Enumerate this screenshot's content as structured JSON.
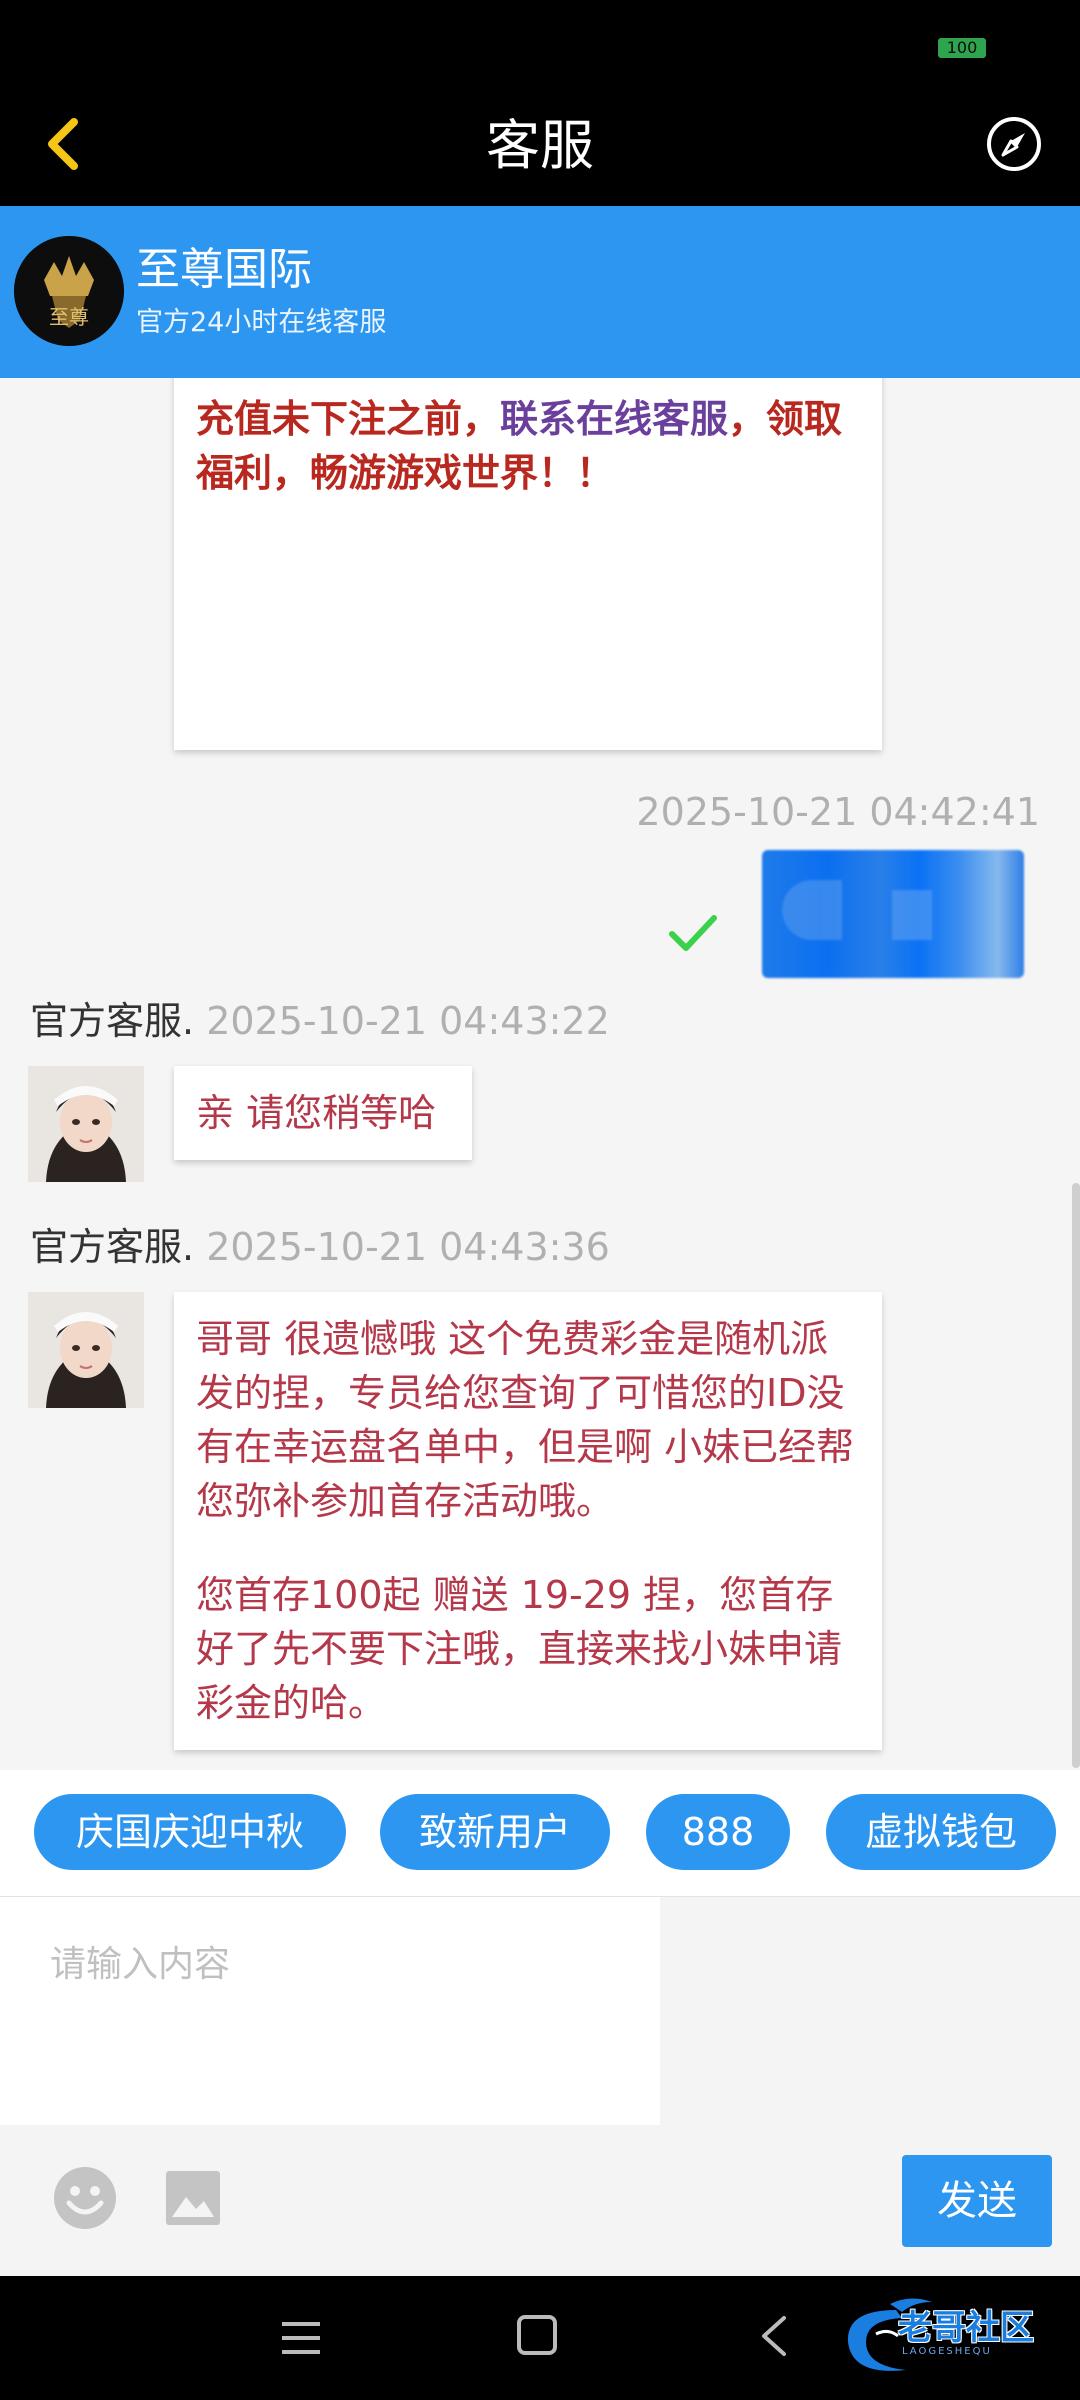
{
  "status_bar": {
    "battery": "100"
  },
  "nav": {
    "title": "客服"
  },
  "header": {
    "name": "至尊国际",
    "subtitle": "官方24小时在线客服",
    "logo_text": "至尊"
  },
  "chat": {
    "top_card": {
      "line_part1": "充值未下注之前，",
      "line_highlight": "联系在线客服",
      "line_part2": "，领取福利，畅游游戏世界！！"
    },
    "user_message": {
      "time": "2025-10-21 04:42:41",
      "status": "delivered"
    },
    "messages": [
      {
        "sender": "官方客服.",
        "time": "2025-10-21 04:43:22",
        "text": "亲 请您稍等哈"
      },
      {
        "sender": "官方客服.",
        "time": "2025-10-21 04:43:36",
        "paragraph1": "哥哥 很遗憾哦 这个免费彩金是随机派发的捏，专员给您查询了可惜您的ID没有在幸运盘名单中，但是啊 小妹已经帮您弥补参加首存活动哦。",
        "paragraph2": "您首存100起 赠送 19-29 捏，您首存好了先不要下注哦，直接来找小妹申请彩金的哈。"
      }
    ]
  },
  "quick_replies": [
    "庆国庆迎中秋",
    "致新用户",
    "888",
    "虚拟钱包"
  ],
  "input": {
    "placeholder": "请输入内容",
    "send_label": "发送"
  },
  "watermark": {
    "text": "老哥社区",
    "sub": "LAOGESHEQU"
  },
  "colors": {
    "accent": "#2c96f0",
    "message_text": "#b5384a",
    "card_red": "#b8281f",
    "card_purple": "#6b3f9c"
  }
}
